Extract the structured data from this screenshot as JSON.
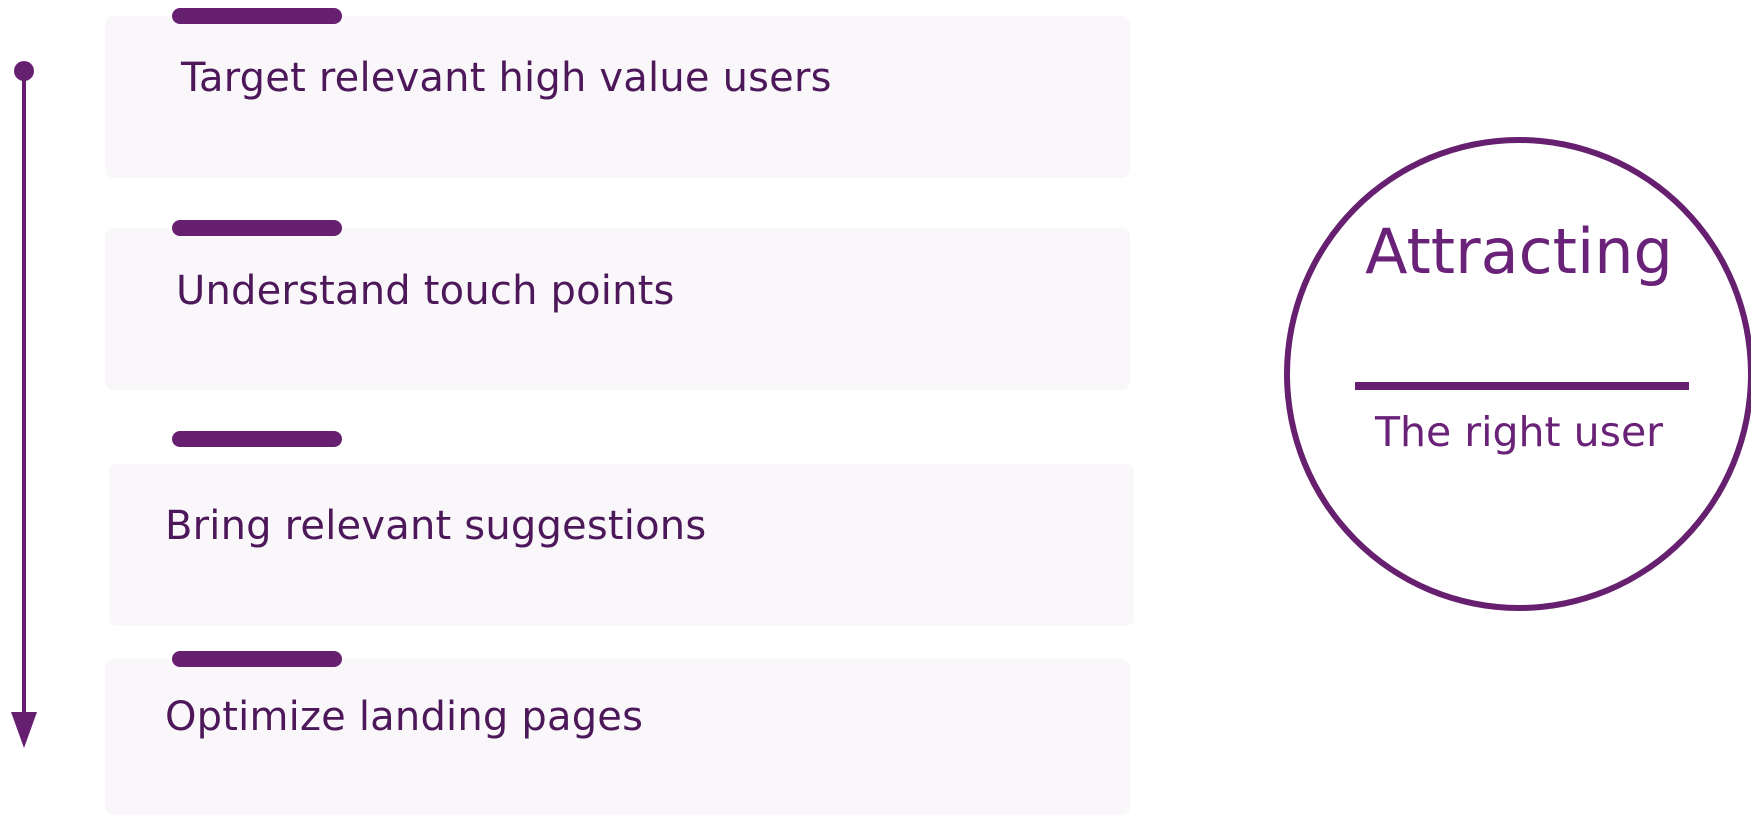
{
  "accent_color": "#66206f",
  "card_color": "#faf7fb",
  "text_color": "#4d1859",
  "steps": [
    {
      "label": "Target relevant high value users"
    },
    {
      "label": "Understand touch points"
    },
    {
      "label": "Bring relevant suggestions"
    },
    {
      "label": "Optimize landing pages"
    }
  ],
  "stage": {
    "title": "Attracting",
    "subtitle": "The right user"
  }
}
